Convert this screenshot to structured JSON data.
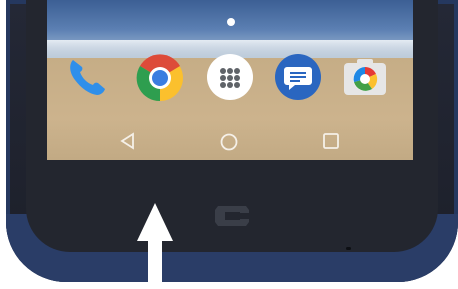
{
  "device": {
    "screen": {
      "page_indicator": "home-page-dot",
      "dock": [
        {
          "name": "phone",
          "icon": "phone-icon",
          "color": "#2f8fea"
        },
        {
          "name": "chrome",
          "icon": "chrome-icon",
          "color": "#dd4b39"
        },
        {
          "name": "app-drawer",
          "icon": "app-drawer-icon",
          "color": "#ffffff"
        },
        {
          "name": "messages",
          "icon": "messages-icon",
          "color": "#2a66c0"
        },
        {
          "name": "camera",
          "icon": "camera-icon",
          "color": "#e8e8e8"
        }
      ],
      "nav": {
        "back": "back-icon",
        "home": "home-circle-icon",
        "recents": "recents-square-icon"
      }
    },
    "brand_logo": "crosscall-logo",
    "gesture": "swipe-up-arrow-icon"
  },
  "colors": {
    "device_frame": "#2a3d67",
    "device_face": "#23262f",
    "arrow": "#ffffff"
  }
}
